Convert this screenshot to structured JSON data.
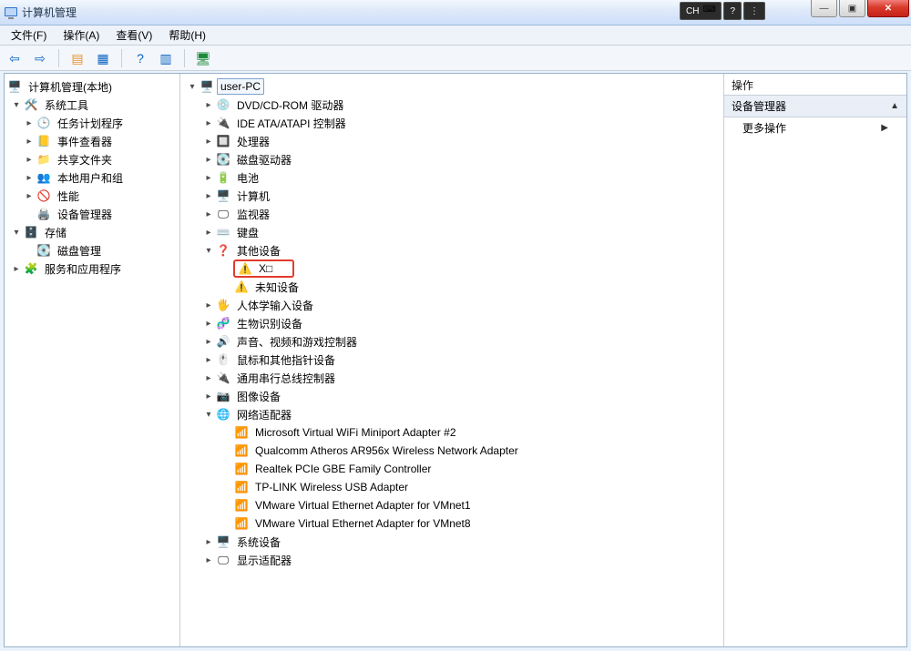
{
  "window": {
    "title": "计算机管理"
  },
  "lang": {
    "ime": "CH",
    "help": "?"
  },
  "winbtns": {
    "min": "—",
    "max": "▣",
    "close": "✕"
  },
  "menu": {
    "file": "文件(F)",
    "action": "操作(A)",
    "view": "查看(V)",
    "help": "帮助(H)"
  },
  "nav": {
    "root": "计算机管理(本地)",
    "system_tools": "系统工具",
    "task_scheduler": "任务计划程序",
    "event_viewer": "事件查看器",
    "shared_folders": "共享文件夹",
    "local_users": "本地用户和组",
    "performance": "性能",
    "device_manager": "设备管理器",
    "storage": "存储",
    "disk_mgmt": "磁盘管理",
    "services_apps": "服务和应用程序"
  },
  "dev": {
    "root": "user-PC",
    "dvd": "DVD/CD-ROM 驱动器",
    "ide": "IDE ATA/ATAPI 控制器",
    "cpu": "处理器",
    "disk": "磁盘驱动器",
    "bat": "电池",
    "comp": "计算机",
    "mon": "监视器",
    "kb": "键盘",
    "other": "其他设备",
    "x": "X□",
    "unknown": "未知设备",
    "hid": "人体学输入设备",
    "bio": "生物识别设备",
    "sound": "声音、视频和游戏控制器",
    "mouse": "鼠标和其他指针设备",
    "usb": "通用串行总线控制器",
    "img": "图像设备",
    "net": "网络适配器",
    "net0": "Microsoft Virtual WiFi Miniport Adapter #2",
    "net1": "Qualcomm Atheros AR956x Wireless Network Adapter",
    "net2": "Realtek PCIe GBE Family Controller",
    "net3": "TP-LINK Wireless USB Adapter",
    "net4": "VMware Virtual Ethernet Adapter for VMnet1",
    "net5": "VMware Virtual Ethernet Adapter for VMnet8",
    "sys": "系统设备",
    "disp": "显示适配器"
  },
  "action": {
    "head": "操作",
    "section": "设备管理器",
    "more": "更多操作"
  }
}
